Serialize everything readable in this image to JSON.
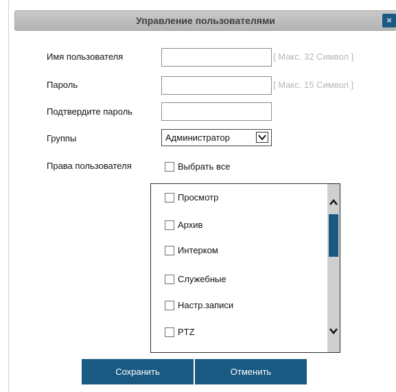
{
  "dialog": {
    "title": "Управление пользователями",
    "close_label": "×"
  },
  "form": {
    "username": {
      "label": "Имя пользователя",
      "value": "",
      "hint": "[ Макс. 32 Символ ]"
    },
    "password": {
      "label": "Пароль",
      "value": "",
      "hint": "[ Макс. 15 Символ ]"
    },
    "confirm_password": {
      "label": "Подтвердите пароль",
      "value": ""
    },
    "group": {
      "label": "Группы",
      "selected": "Администратор"
    },
    "rights": {
      "label": "Права пользователя",
      "select_all": "Выбрать все",
      "items": [
        {
          "label": "Просмотр",
          "checked": false
        },
        {
          "label": "Архив",
          "checked": false
        },
        {
          "label": "Интерком",
          "checked": false
        },
        {
          "label": "Служебные",
          "checked": false
        },
        {
          "label": "Настр.записи",
          "checked": false
        },
        {
          "label": "PTZ",
          "checked": false
        }
      ]
    }
  },
  "buttons": {
    "save": "Сохранить",
    "cancel": "Отменить"
  },
  "colors": {
    "accent": "#1a5a82",
    "titlebar": "#b9b9b9",
    "hint": "#b5b5b5"
  }
}
